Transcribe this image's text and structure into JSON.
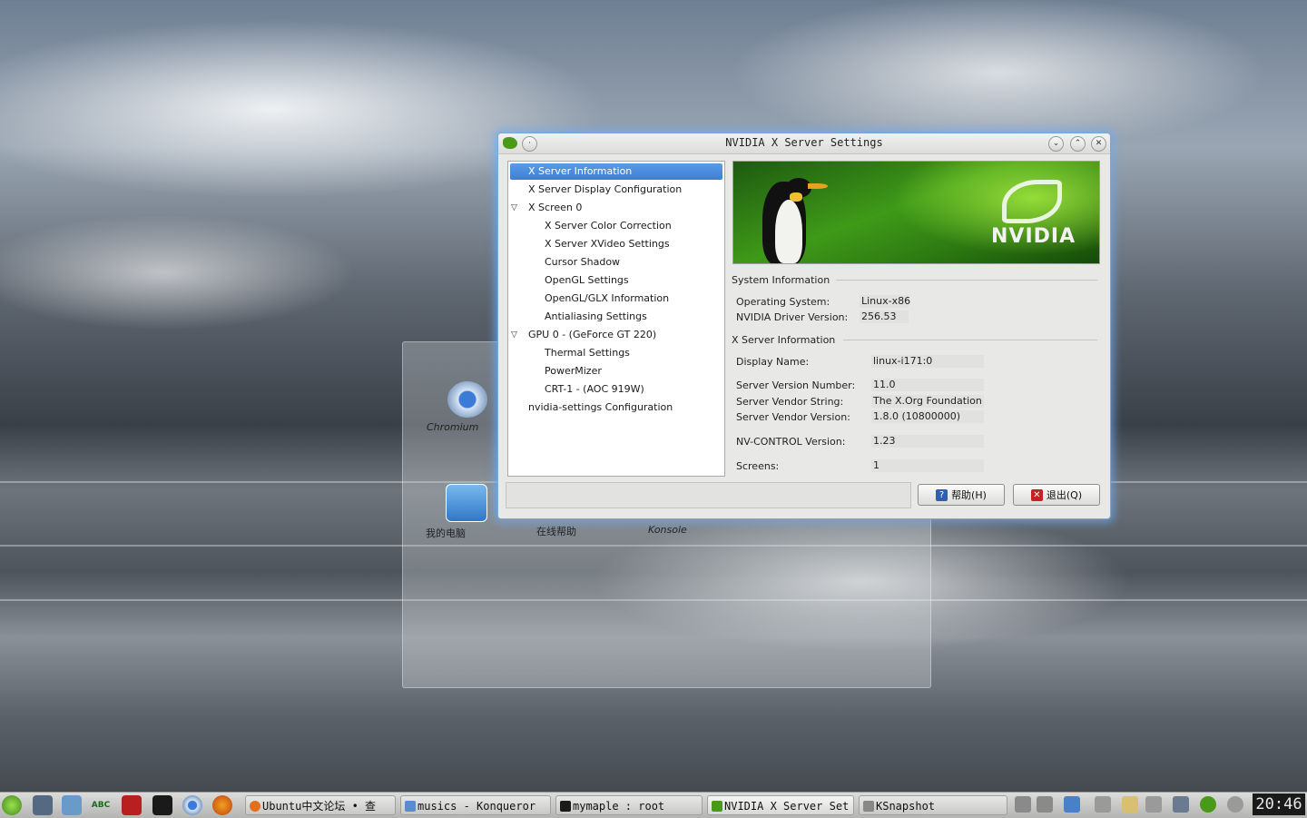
{
  "window": {
    "title": "NVIDIA X Server Settings",
    "buttons": {
      "minimize": "⌄",
      "maximize": "⌃",
      "close": "✕",
      "menu": "·"
    }
  },
  "tree": [
    {
      "label": "X Server Information",
      "selected": true
    },
    {
      "label": "X Server Display Configuration"
    },
    {
      "label": "X Screen 0",
      "expander": "▽"
    },
    {
      "label": "X Server Color Correction"
    },
    {
      "label": "X Server XVideo Settings"
    },
    {
      "label": "Cursor Shadow"
    },
    {
      "label": "OpenGL Settings"
    },
    {
      "label": "OpenGL/GLX Information"
    },
    {
      "label": "Antialiasing Settings"
    },
    {
      "label": "GPU 0 - (GeForce GT 220)",
      "expander": "▽"
    },
    {
      "label": "Thermal Settings"
    },
    {
      "label": "PowerMizer"
    },
    {
      "label": "CRT-1 - (AOC 919W)"
    },
    {
      "label": "nvidia-settings Configuration"
    }
  ],
  "banner": {
    "brand": "NVIDIA"
  },
  "system_info": {
    "heading": "System Information",
    "os_label": "Operating System:",
    "os_value": "Linux-x86",
    "driver_label": "NVIDIA Driver Version:",
    "driver_value": "256.53"
  },
  "xserver_info": {
    "heading": "X Server Information",
    "display_label": "Display Name:",
    "display_value": "linux-i171:0",
    "version_label": "Server Version Number:",
    "version_value": "11.0",
    "vendor_label": "Server Vendor String:",
    "vendor_value": "The X.Org Foundation",
    "vendor_ver_label": "Server Vendor Version:",
    "vendor_ver_value": "1.8.0 (10800000)",
    "nvcontrol_label": "NV-CONTROL Version:",
    "nvcontrol_value": "1.23",
    "screens_label": "Screens:",
    "screens_value": "1"
  },
  "actions": {
    "help": "帮助(H)",
    "quit": "退出(Q)"
  },
  "desktop": {
    "chromium": "Chromium",
    "my_computer": "我的电脑",
    "online_help": "在线帮助",
    "konsole": "Konsole"
  },
  "taskbar": {
    "tasks": [
      {
        "label": "Ubuntu中文论坛 • 查"
      },
      {
        "label": "musics - Konqueror"
      },
      {
        "label": "mymaple : root"
      },
      {
        "label": "NVIDIA X Server Set"
      },
      {
        "label": "KSnapshot"
      }
    ],
    "launchers": {
      "abc": "ABC"
    },
    "clock": "20:46"
  },
  "colors": {
    "nvidia_green": "#76b900",
    "selection": "#3c7fd3",
    "window_glow": "#6eaaf0"
  }
}
